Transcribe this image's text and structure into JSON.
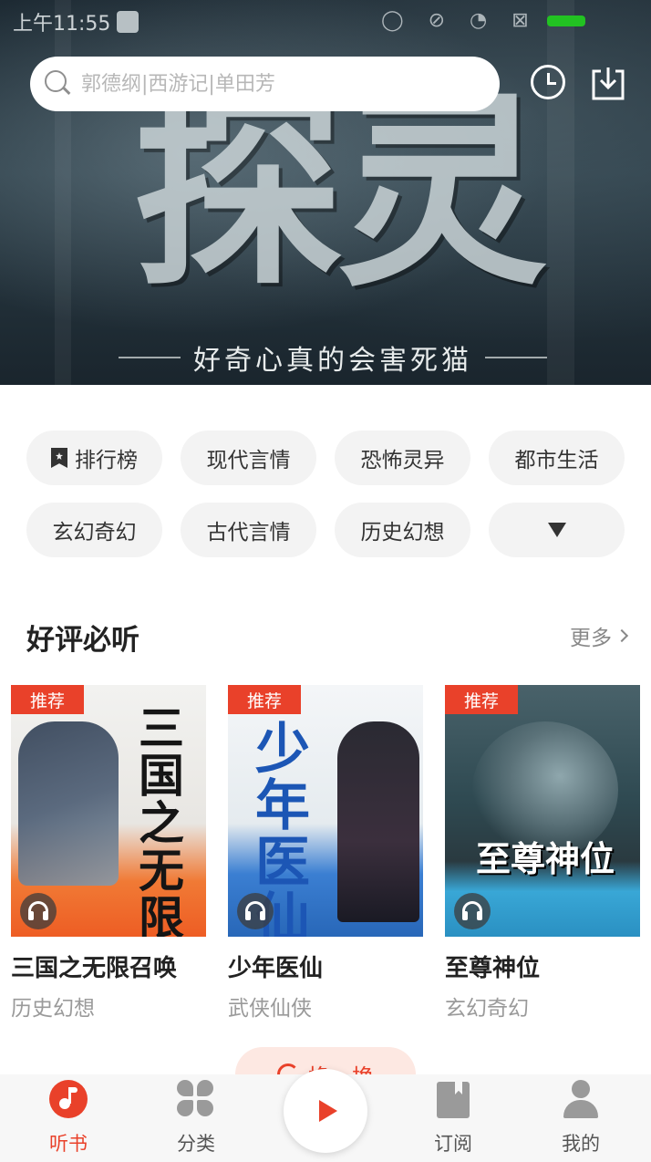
{
  "status_bar": {
    "time": "上午11:55"
  },
  "banner": {
    "title": "探灵",
    "tagline": "好奇心真的会害死猫"
  },
  "search": {
    "placeholder": "郭德纲|西游记|单田芳"
  },
  "categories": [
    {
      "label": "排行榜",
      "icon": "bookmark-star-icon"
    },
    {
      "label": "现代言情"
    },
    {
      "label": "恐怖灵异"
    },
    {
      "label": "都市生活"
    },
    {
      "label": "玄幻奇幻"
    },
    {
      "label": "古代言情"
    },
    {
      "label": "历史幻想"
    },
    {
      "label": "",
      "icon": "triangle-down-icon"
    }
  ],
  "section": {
    "title": "好评必听",
    "more": "更多"
  },
  "books": [
    {
      "badge": "推荐",
      "cover_text": "三国之无限召唤",
      "title": "三国之无限召唤",
      "genre": "历史幻想"
    },
    {
      "badge": "推荐",
      "cover_text": "少年医仙",
      "title": "少年医仙",
      "genre": "武侠仙侠"
    },
    {
      "badge": "推荐",
      "cover_text": "至尊神位",
      "title": "至尊神位",
      "genre": "玄幻奇幻"
    }
  ],
  "swap_button": {
    "label": "换一换"
  },
  "tabs": [
    {
      "label": "听书",
      "icon": "music-note-icon",
      "active": true
    },
    {
      "label": "分类",
      "icon": "grid-icon"
    },
    {
      "label": "订阅",
      "icon": "book-icon"
    },
    {
      "label": "我的",
      "icon": "person-icon"
    }
  ],
  "colors": {
    "accent": "#e9412a",
    "chip_bg": "#f3f3f3",
    "tabbar_bg": "#f7f7f7"
  }
}
